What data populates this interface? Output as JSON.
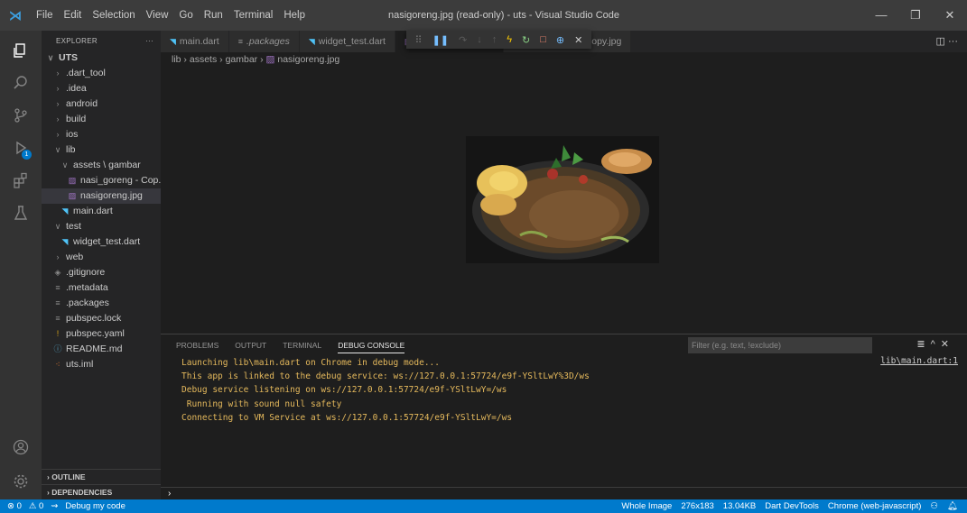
{
  "titlebar": {
    "menu": [
      "File",
      "Edit",
      "Selection",
      "View",
      "Go",
      "Run",
      "Terminal",
      "Help"
    ],
    "title": "nasigoreng.jpg (read-only) - uts - Visual Studio Code"
  },
  "explorer": {
    "header": "EXPLORER",
    "more": "···",
    "tree": [
      {
        "label": "UTS",
        "indent": 0,
        "icon": "∨",
        "kind": "root"
      },
      {
        "label": ".dart_tool",
        "indent": 1,
        "icon": "›",
        "kind": "folder"
      },
      {
        "label": ".idea",
        "indent": 1,
        "icon": "›",
        "kind": "folder"
      },
      {
        "label": "android",
        "indent": 1,
        "icon": "›",
        "kind": "folder"
      },
      {
        "label": "build",
        "indent": 1,
        "icon": "›",
        "kind": "folder"
      },
      {
        "label": "ios",
        "indent": 1,
        "icon": "›",
        "kind": "folder"
      },
      {
        "label": "lib",
        "indent": 1,
        "icon": "∨",
        "kind": "folder"
      },
      {
        "label": "assets \\ gambar",
        "indent": 2,
        "icon": "∨",
        "kind": "folder"
      },
      {
        "label": "nasi_goreng - Cop...",
        "indent": 3,
        "icon": "▨",
        "kind": "img"
      },
      {
        "label": "nasigoreng.jpg",
        "indent": 3,
        "icon": "▨",
        "kind": "img",
        "selected": true
      },
      {
        "label": "main.dart",
        "indent": 2,
        "icon": "◥",
        "kind": "dart"
      },
      {
        "label": "test",
        "indent": 1,
        "icon": "∨",
        "kind": "folder"
      },
      {
        "label": "widget_test.dart",
        "indent": 2,
        "icon": "◥",
        "kind": "dart"
      },
      {
        "label": "web",
        "indent": 1,
        "icon": "›",
        "kind": "folder"
      },
      {
        "label": ".gitignore",
        "indent": 1,
        "icon": "◈",
        "kind": "file"
      },
      {
        "label": ".metadata",
        "indent": 1,
        "icon": "≡",
        "kind": "file"
      },
      {
        "label": ".packages",
        "indent": 1,
        "icon": "≡",
        "kind": "file"
      },
      {
        "label": "pubspec.lock",
        "indent": 1,
        "icon": "≡",
        "kind": "file"
      },
      {
        "label": "pubspec.yaml",
        "indent": 1,
        "icon": "!",
        "kind": "yml"
      },
      {
        "label": "README.md",
        "indent": 1,
        "icon": "ⓘ",
        "kind": "info"
      },
      {
        "label": "uts.iml",
        "indent": 1,
        "icon": "⁖",
        "kind": "iml"
      }
    ],
    "outline": "OUTLINE",
    "dependencies": "DEPENDENCIES"
  },
  "tabs": [
    {
      "label": "main.dart",
      "icon": "◥",
      "kind": "dart"
    },
    {
      "label": ".packages",
      "icon": "≡",
      "kind": "file"
    },
    {
      "label": "widget_test.dart",
      "icon": "◥",
      "kind": "dart"
    },
    {
      "label": "nasigoreng.jpg",
      "icon": "▨",
      "kind": "img",
      "active": true
    },
    {
      "label": "nasi_goreng - Copy.jpg",
      "icon": "▨",
      "kind": "img"
    }
  ],
  "breadcrumb": [
    "lib",
    "assets",
    "gambar",
    "nasigoreng.jpg"
  ],
  "panel": {
    "tabs": [
      "PROBLEMS",
      "OUTPUT",
      "TERMINAL",
      "DEBUG CONSOLE"
    ],
    "filter_placeholder": "Filter (e.g. text, !exclude)",
    "console_lines": [
      "Launching lib\\main.dart on Chrome in debug mode...",
      "This app is linked to the debug service: ws://127.0.0.1:57724/e9f-YSltLwY%3D/ws",
      "Debug service listening on ws://127.0.0.1:57724/e9f-YSltLwY=/ws",
      " Running with sound null safety",
      "Connecting to VM Service at ws://127.0.0.1:57724/e9f-YSltLwY=/ws"
    ],
    "source_link": "lib\\main.dart:1",
    "prompt": "›"
  },
  "statusbar": {
    "errors": "⊗ 0",
    "warnings": "⚠ 0",
    "debug": "Debug my code",
    "right": [
      "Whole Image",
      "276x183",
      "13.04KB",
      "Dart DevTools",
      "Chrome (web-javascript)"
    ]
  },
  "badge_count": "1"
}
